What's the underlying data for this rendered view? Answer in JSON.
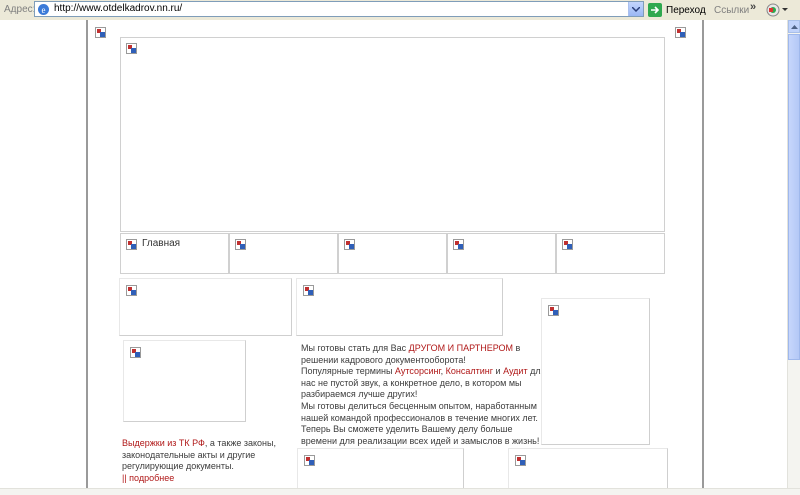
{
  "addressbar": {
    "label": "Адрес:",
    "url": "http://www.otdelkadrov.nn.ru/",
    "go_label": "Переход",
    "links_label": "Ссылки",
    "chevron": "»"
  },
  "nav": {
    "home_label": "Главная"
  },
  "left_block": {
    "link_text": "Выдержки из ТК РФ",
    "text": ", а также законы, законодательные акты и другие регулирующие документы.",
    "more_link": "|| подробнее"
  },
  "intro": {
    "p1_a": "Мы готовы стать для Вас ",
    "p1_link": "ДРУГОМ И ПАРТНЕРОМ",
    "p1_b": " в решении кадрового документооборота!",
    "p2_a": "Популярные термины ",
    "p2_link1": "Аутсорсинг",
    "p2_sep": ", ",
    "p2_link2": "Консалтинг",
    "p2_and": " и ",
    "p2_link3": "Аудит",
    "p2_b": " для нас не пустой звук, а конкретное дело, в котором мы разбираемся лучше других!",
    "p3": "Мы готовы делиться бесценным опытом, наработанным нашей командой профессионалов в течение многих лет.",
    "p4": "Теперь Вы сможете уделить Вашему делу больше времени для реализации всех идей и замыслов в жизнь!"
  },
  "colors": {
    "link_red": "#b01818",
    "border": "#d0d0d0",
    "page_border": "#9a9a9a",
    "toolbar_bg": "#ece9d8"
  }
}
